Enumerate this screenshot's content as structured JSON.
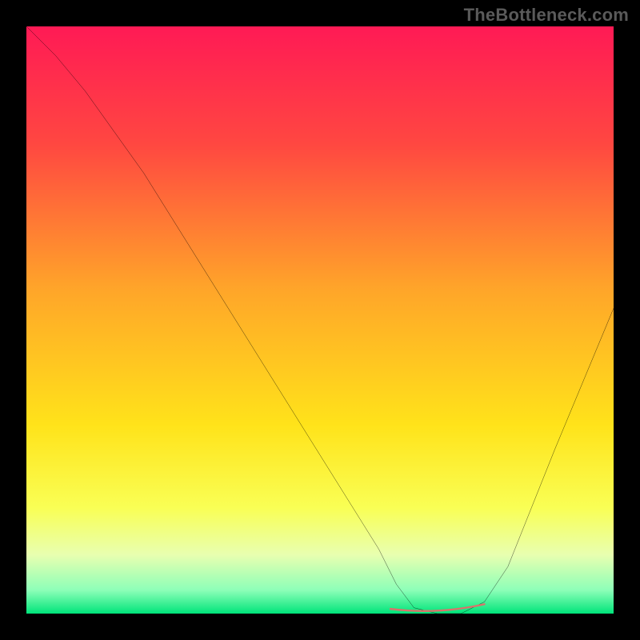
{
  "attribution": "TheBottleneck.com",
  "chart_data": {
    "type": "line",
    "title": "",
    "xlabel": "",
    "ylabel": "",
    "xlim": [
      0,
      100
    ],
    "ylim": [
      0,
      100
    ],
    "grid": false,
    "series": [
      {
        "name": "bottleneck-curve",
        "x": [
          0,
          5,
          10,
          15,
          20,
          25,
          30,
          35,
          40,
          45,
          50,
          55,
          60,
          63,
          66,
          70,
          74,
          78,
          82,
          86,
          90,
          95,
          100
        ],
        "y": [
          100,
          95,
          89,
          82,
          75,
          67,
          59,
          51,
          43,
          35,
          27,
          19,
          11,
          5,
          1,
          0,
          0,
          2,
          8,
          18,
          28,
          40,
          52
        ]
      }
    ],
    "annotations": [
      {
        "name": "optimal-region",
        "x_start": 62,
        "x_end": 78,
        "y": 0
      }
    ],
    "background": {
      "type": "vertical-gradient",
      "stops": [
        {
          "pos": 0.0,
          "color": "#ff1a55"
        },
        {
          "pos": 0.2,
          "color": "#ff4741"
        },
        {
          "pos": 0.45,
          "color": "#ffa629"
        },
        {
          "pos": 0.68,
          "color": "#ffe31a"
        },
        {
          "pos": 0.82,
          "color": "#f9ff55"
        },
        {
          "pos": 0.9,
          "color": "#e8ffb0"
        },
        {
          "pos": 0.96,
          "color": "#8dffb8"
        },
        {
          "pos": 1.0,
          "color": "#00e47a"
        }
      ]
    },
    "colors": {
      "curve": "#000000",
      "marker": "#d9736b"
    }
  }
}
